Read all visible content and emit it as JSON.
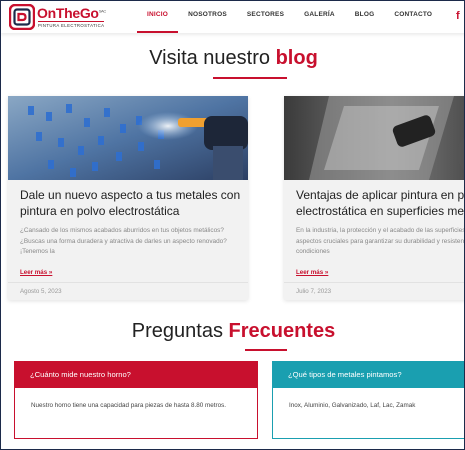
{
  "brand": {
    "name": "OnTheGo",
    "suffix": "SAC",
    "tagline": "PINTURA ELECTROSTATICA",
    "color": "#c8102e"
  },
  "nav": {
    "items": [
      "INICIO",
      "NOSOTROS",
      "SECTORES",
      "GALERÍA",
      "BLOG",
      "CONTACTO"
    ],
    "active": "INICIO",
    "social_icon": "facebook-icon"
  },
  "blog_section": {
    "title_plain": "Visita nuestro",
    "title_accent": "blog"
  },
  "posts": [
    {
      "title": "Dale un nuevo aspecto a tus metales con pintura en polvo electrostática",
      "excerpt": "¿Cansado de los mismos acabados aburridos en tus objetos metálicos? ¿Buscas una forma duradera y atractiva de darles un aspecto renovado? ¡Tenemos la",
      "link": "Leer más »",
      "date": "Agosto 5, 2023"
    },
    {
      "title": "Ventajas de aplicar pintura en polvo electrostática en superficies metálicas",
      "excerpt": "En la industria, la protección y el acabado de las superficies metálicas son aspectos cruciales para garantizar su durabilidad y resistencia ante condiciones",
      "link": "Leer más »",
      "date": "Julio 7, 2023"
    }
  ],
  "faq_section": {
    "title_plain": "Preguntas",
    "title_accent": "Frecuentes"
  },
  "faqs": [
    {
      "question": "¿Cuánto mide nuestro horno?",
      "answer": "Nuestro horno tiene una capacidad para piezas de hasta 8.80 metros.",
      "color": "#c8102e"
    },
    {
      "question": "¿Qué tipos de metales pintamos?",
      "answer": "Inox, Aluminio, Galvanizado, Laf, Lac, Zamak",
      "color": "#1a9fb0"
    }
  ]
}
